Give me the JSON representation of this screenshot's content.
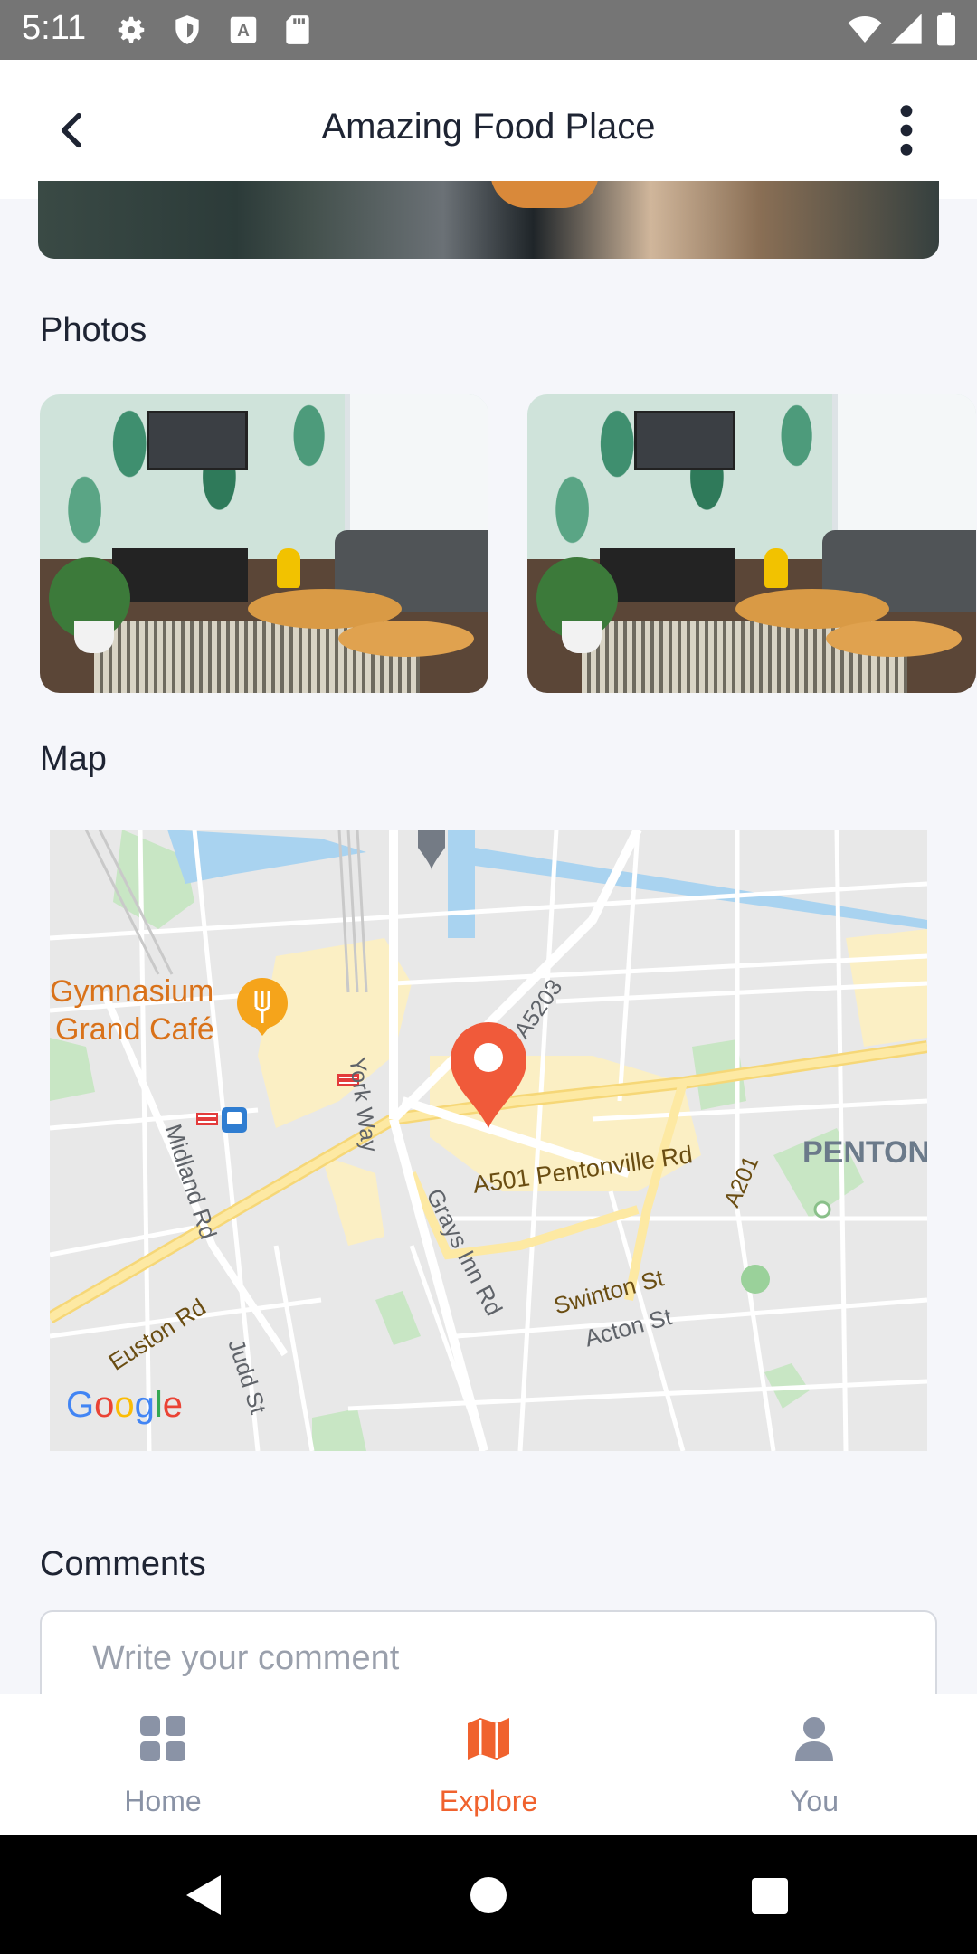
{
  "status_bar": {
    "time": "5:11",
    "icons": [
      "settings-icon",
      "shield-icon",
      "text-a-icon",
      "sd-card-icon",
      "wifi-icon",
      "signal-icon",
      "battery-icon"
    ]
  },
  "app_bar": {
    "title": "Amazing Food Place",
    "back_icon": "chevron-left-icon",
    "menu_icon": "more-vertical-icon"
  },
  "sections": {
    "photos_title": "Photos",
    "map_title": "Map",
    "comments_title": "Comments"
  },
  "photos": [
    "living-room-photo",
    "living-room-photo"
  ],
  "map": {
    "labels": {
      "poi_name_line1": "Gymnasium",
      "poi_name_line2": "Grand Café",
      "york_way": "York Way",
      "a5203": "A5203",
      "pentonville": "A501  Pentonville Rd",
      "midland": "Midland Rd",
      "grays_inn": "Grays Inn Rd",
      "a201": "A201",
      "penton": "PENTON",
      "swinton": "Swinton St",
      "acton": "Acton St",
      "euston": "Euston Rd",
      "judd": "Judd St",
      "logo": "Google"
    }
  },
  "comment": {
    "placeholder": "Write your comment"
  },
  "bottom_nav": {
    "items": [
      {
        "label": "Home",
        "icon": "grid-icon",
        "active": false
      },
      {
        "label": "Explore",
        "icon": "map-icon",
        "active": true
      },
      {
        "label": "You",
        "icon": "person-icon",
        "active": false
      }
    ],
    "active_color": "#f0622e",
    "inactive_color": "#8a93a6"
  }
}
